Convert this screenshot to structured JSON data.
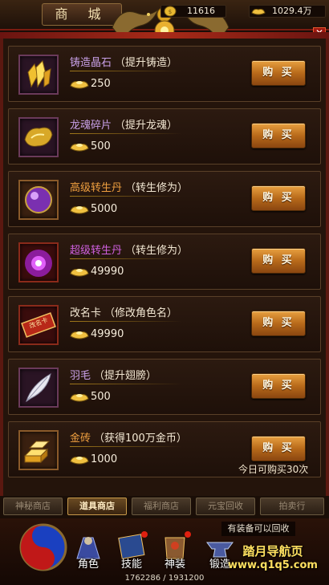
{
  "header": {
    "title": "商 城",
    "gold_amount": "11616",
    "ingot_amount": "1029.4万"
  },
  "items": [
    {
      "name": "铸造晶石",
      "desc": "（提升铸造）",
      "price": "250",
      "name_color": "#c8a0e8",
      "buy_label": "购 买",
      "icon": "yellow-crystal-icon"
    },
    {
      "name": "龙魂碎片",
      "desc": "（提升龙魂）",
      "price": "500",
      "name_color": "#c8a0e8",
      "buy_label": "购 买",
      "icon": "dragon-soul-shard-icon"
    },
    {
      "name": "高级转生丹",
      "desc": "（转生修为）",
      "price": "5000",
      "name_color": "#f0a040",
      "buy_label": "购 买",
      "icon": "purple-orb-icon"
    },
    {
      "name": "超级转生丹",
      "desc": "（转生修为）",
      "price": "49990",
      "name_color": "#d060e0",
      "buy_label": "购 买",
      "icon": "purple-elixir-icon"
    },
    {
      "name": "改名卡",
      "desc": "（修改角色名）",
      "price": "49990",
      "name_color": "#f4e9d4",
      "buy_label": "购 买",
      "icon": "rename-card-icon"
    },
    {
      "name": "羽毛",
      "desc": "（提升翅膀）",
      "price": "500",
      "name_color": "#c8a0e8",
      "buy_label": "购 买",
      "icon": "feather-icon"
    },
    {
      "name": "金砖",
      "desc": "（获得100万金币）",
      "price": "1000",
      "name_color": "#f0a040",
      "buy_label": "购 买",
      "icon": "gold-brick-icon"
    }
  ],
  "rename_card_text": "改名卡",
  "daily_limit": "今日可购买30次",
  "tabs": [
    "神秘商店",
    "道具商店",
    "福利商店",
    "元宝回收",
    "拍卖行"
  ],
  "active_tab": 1,
  "hud": {
    "buttons": [
      "角色",
      "技能",
      "神装",
      "锻造"
    ],
    "notice": "有装备可以回收",
    "exp": "1762286 / 1931200",
    "watermark_line1": "踏月导航页",
    "watermark_line2": "www.q1q5.com"
  },
  "colors": {
    "buy_button": "#c87a24",
    "frame_red": "#a82a18",
    "active_tab_border": "#c89a4a"
  }
}
